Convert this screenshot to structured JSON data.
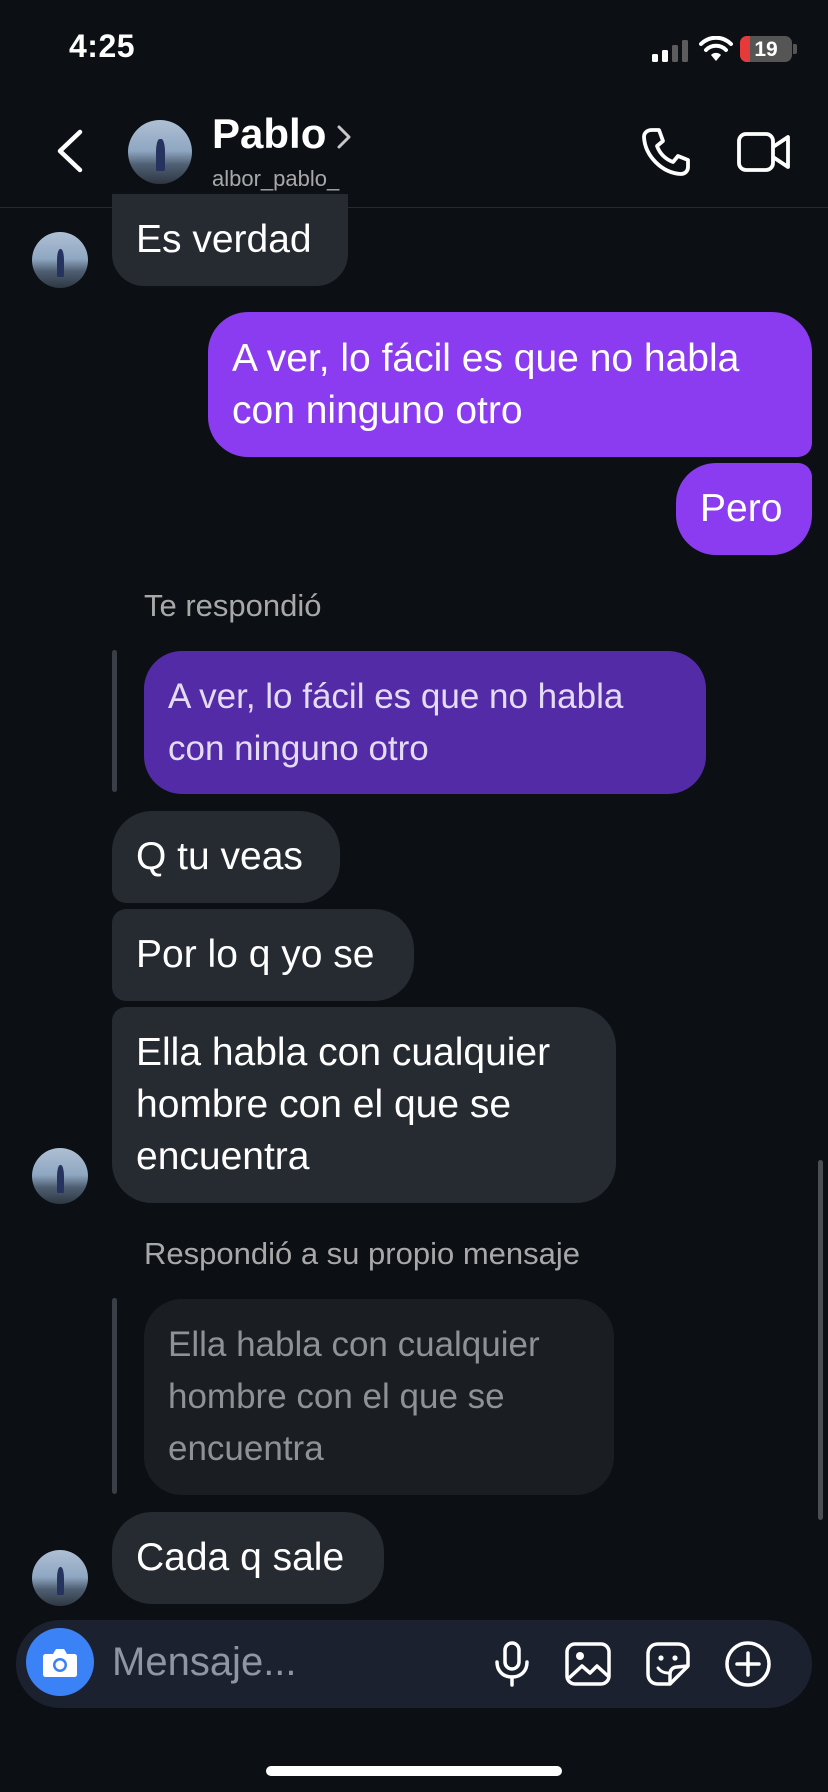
{
  "status_bar": {
    "time": "4:25",
    "battery": "19",
    "battery_level": 0.19
  },
  "header": {
    "name": "Pablo",
    "username": "albor_pablo_"
  },
  "messages": [
    {
      "text": "Es verdad"
    },
    {
      "text": "A ver, lo fácil es que no habla con ninguno otro"
    },
    {
      "text": "Pero"
    },
    {
      "reply_label": "Te respondió",
      "quote": "A ver, lo fácil es que no habla con ninguno otro"
    },
    {
      "text": "Q tu veas"
    },
    {
      "text": "Por lo q yo se"
    },
    {
      "text": "Ella habla con cualquier hombre con el que se encuentra"
    },
    {
      "reply_label": "Respondió a su propio mensaje",
      "quote": "Ella habla con cualquier hombre con el que se encuentra"
    },
    {
      "text": "Cada q sale"
    }
  ],
  "composer": {
    "placeholder": "Mensaje..."
  },
  "colors": {
    "outgoing": "#8c3cf0",
    "incoming": "#262a31",
    "background": "#0c1014",
    "camera": "#3b82f6"
  },
  "icons": [
    "chevron-left-icon",
    "chevron-right-icon",
    "phone-icon",
    "video-camera-icon",
    "camera-icon",
    "microphone-icon",
    "image-icon",
    "sticker-icon",
    "plus-circle-icon"
  ]
}
